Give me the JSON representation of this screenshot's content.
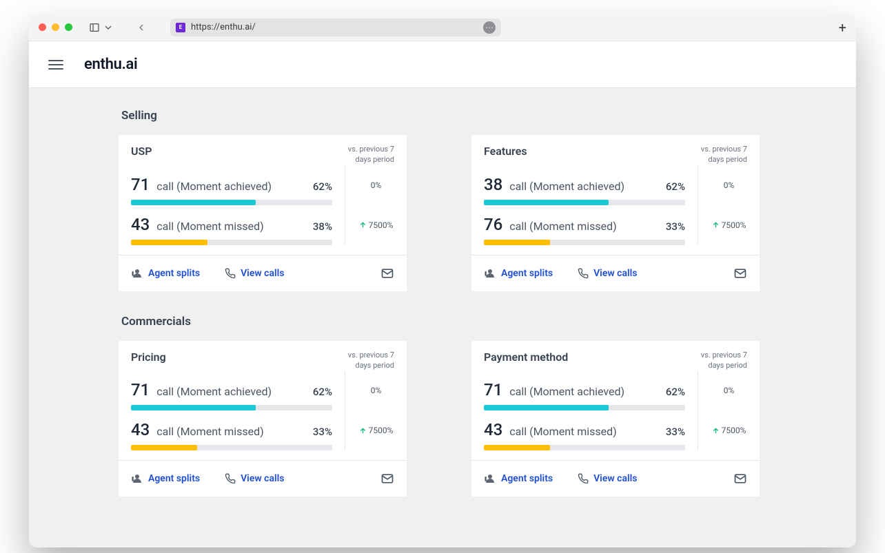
{
  "browser": {
    "url": "https://enthu.ai/",
    "favicon_letter": "E"
  },
  "app": {
    "brand": "enthu.ai"
  },
  "sections": [
    {
      "title": "Selling",
      "cards": [
        {
          "title": "USP",
          "compare_label": "vs. previous 7 days period",
          "achieved": {
            "count": 71,
            "label": "call (Moment achieved)",
            "pct": "62%",
            "bar": 62,
            "delta": "0%",
            "delta_up": false
          },
          "missed": {
            "count": 43,
            "label": "call (Moment missed)",
            "pct": "38%",
            "bar": 38,
            "delta": "7500%",
            "delta_up": true
          }
        },
        {
          "title": "Features",
          "compare_label": "vs. previous 7 days period",
          "achieved": {
            "count": 38,
            "label": "call (Moment achieved)",
            "pct": "62%",
            "bar": 62,
            "delta": "0%",
            "delta_up": false
          },
          "missed": {
            "count": 76,
            "label": "call (Moment missed)",
            "pct": "33%",
            "bar": 33,
            "delta": "7500%",
            "delta_up": true
          }
        }
      ]
    },
    {
      "title": "Commercials",
      "cards": [
        {
          "title": "Pricing",
          "compare_label": "vs. previous 7 days period",
          "achieved": {
            "count": 71,
            "label": "call (Moment achieved)",
            "pct": "62%",
            "bar": 62,
            "delta": "0%",
            "delta_up": false
          },
          "missed": {
            "count": 43,
            "label": "call (Moment missed)",
            "pct": "33%",
            "bar": 33,
            "delta": "7500%",
            "delta_up": true
          }
        },
        {
          "title": "Payment method",
          "compare_label": "vs. previous 7 days period",
          "achieved": {
            "count": 71,
            "label": "call (Moment achieved)",
            "pct": "62%",
            "bar": 62,
            "delta": "0%",
            "delta_up": false
          },
          "missed": {
            "count": 43,
            "label": "call (Moment missed)",
            "pct": "33%",
            "bar": 33,
            "delta": "7500%",
            "delta_up": true
          }
        }
      ]
    }
  ],
  "links": {
    "agent_splits": "Agent splits",
    "view_calls": "View calls"
  }
}
